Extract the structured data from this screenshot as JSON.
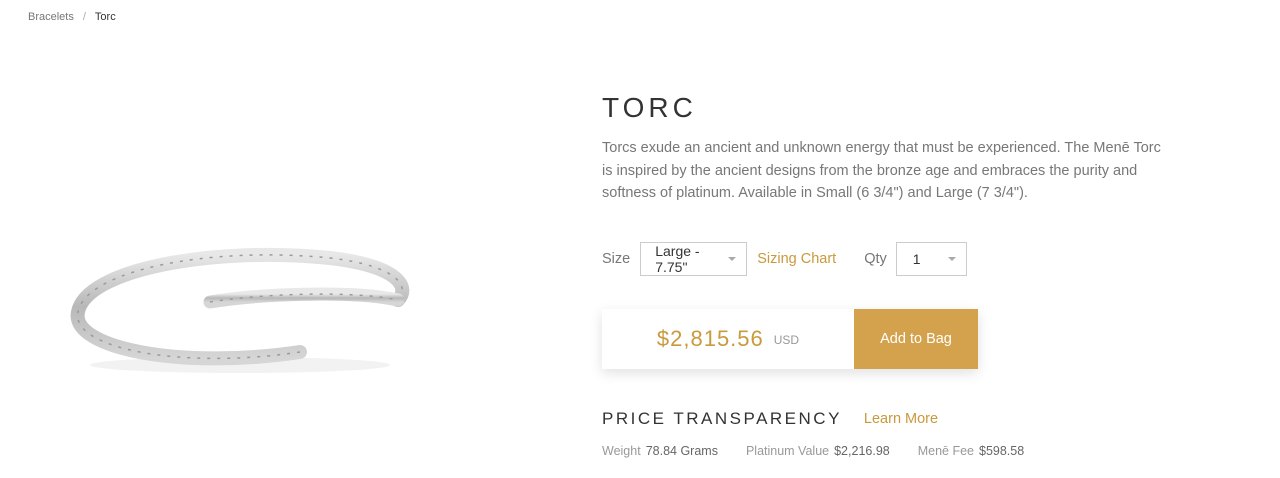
{
  "breadcrumb": {
    "parent": "Bracelets",
    "separator": "/",
    "current": "Torc"
  },
  "product": {
    "title": "TORC",
    "description": "Torcs exude an ancient and unknown energy that must be experienced. The Menē Torc is inspired by the ancient designs from the bronze age and embraces the purity and softness of platinum. Available in Small (6 3/4\") and Large (7 3/4\")."
  },
  "options": {
    "size_label": "Size",
    "size_value": "Large - 7.75\"",
    "sizing_chart": "Sizing Chart",
    "qty_label": "Qty",
    "qty_value": "1"
  },
  "purchase": {
    "price": "$2,815.56",
    "currency": "USD",
    "add_button": "Add to Bag"
  },
  "transparency": {
    "heading": "PRICE TRANSPARENCY",
    "learn_more": "Learn More",
    "metrics": [
      {
        "label": "Weight",
        "value": "78.84 Grams"
      },
      {
        "label": "Platinum Value",
        "value": "$2,216.98"
      },
      {
        "label": "Menē Fee",
        "value": "$598.58"
      }
    ]
  },
  "colors": {
    "accent": "#c99a3c",
    "button": "#d4a24c",
    "text": "#333333",
    "muted": "#777777"
  }
}
